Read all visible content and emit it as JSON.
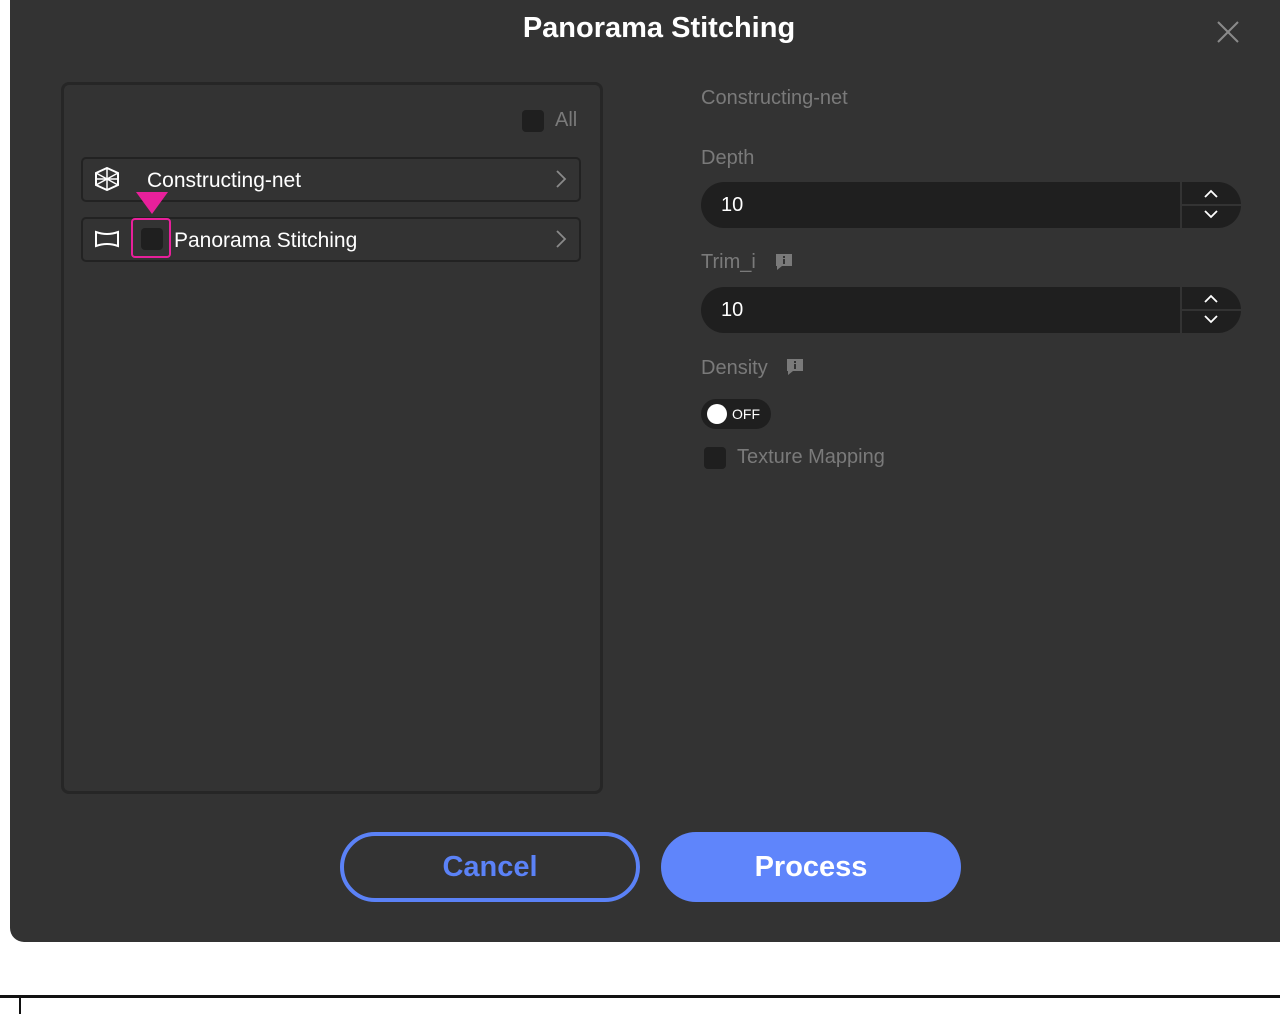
{
  "dialog": {
    "title": "Panorama Stitching"
  },
  "left_panel": {
    "all_label": "All",
    "items": [
      {
        "label": "Constructing-net",
        "icon": "cube-net-icon"
      },
      {
        "label": "Panorama Stitching",
        "icon": "panorama-icon"
      }
    ]
  },
  "right_panel": {
    "section_title": "Constructing-net",
    "depth": {
      "label": "Depth",
      "value": "10"
    },
    "trim": {
      "label": "Trim_i",
      "value": "10"
    },
    "density": {
      "label": "Density",
      "toggle_text": "OFF"
    },
    "texture": {
      "label": "Texture Mapping"
    }
  },
  "buttons": {
    "cancel": "Cancel",
    "process": "Process"
  },
  "colors": {
    "accent": "#5f85fb",
    "highlight": "#e8209b",
    "dialog_bg": "#333333"
  }
}
